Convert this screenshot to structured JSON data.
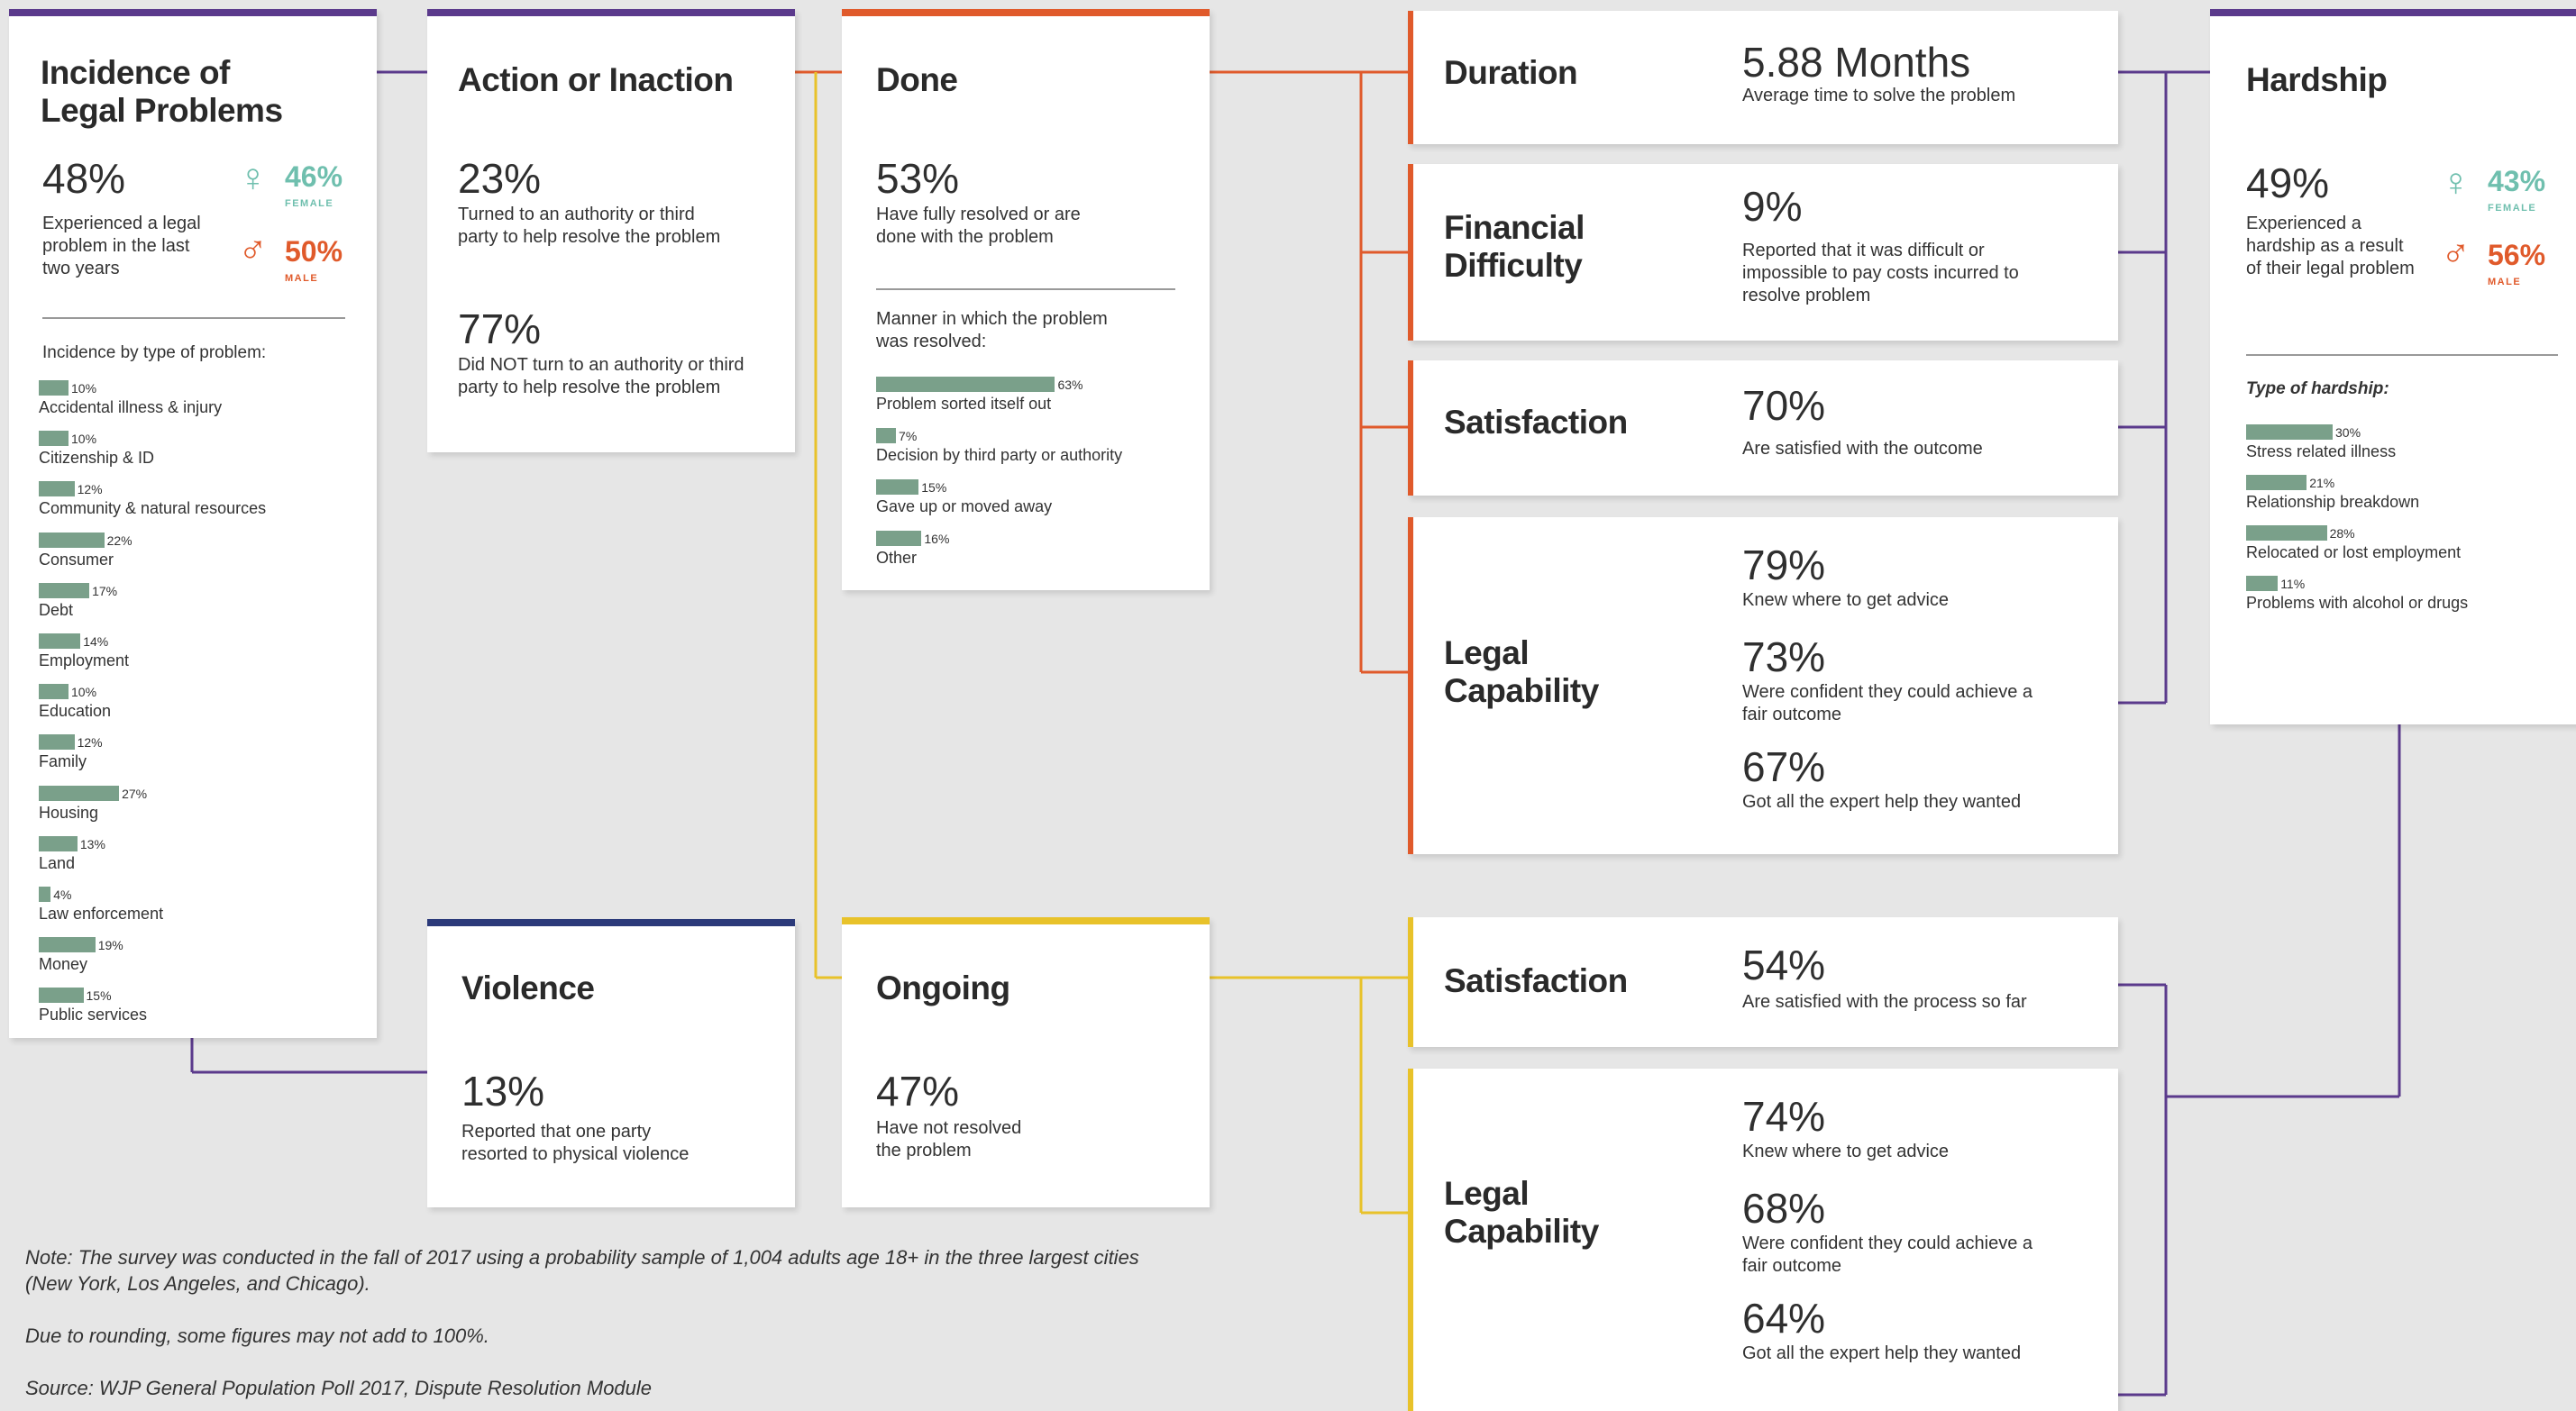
{
  "colors": {
    "purple": "#5b3a8c",
    "orange": "#e05a2b",
    "navy": "#2b3a7a",
    "yellow": "#e8c22a",
    "bar": "#7aa08a",
    "female": "#6fbfae"
  },
  "incidence": {
    "title_line1": "Incidence of",
    "title_line2": "Legal Problems",
    "pct": "48%",
    "desc_line1": "Experienced a legal",
    "desc_line2": "problem in the last",
    "desc_line3": "two years",
    "female_pct": "46%",
    "female_label": "FEMALE",
    "male_pct": "50%",
    "male_label": "MALE",
    "type_heading": "Incidence by type of problem:",
    "types": [
      {
        "label": "Accidental illness & injury",
        "value": 10,
        "pct": "10%"
      },
      {
        "label": "Citizenship & ID",
        "value": 10,
        "pct": "10%"
      },
      {
        "label": "Community & natural resources",
        "value": 12,
        "pct": "12%"
      },
      {
        "label": "Consumer",
        "value": 22,
        "pct": "22%"
      },
      {
        "label": "Debt",
        "value": 17,
        "pct": "17%"
      },
      {
        "label": "Employment",
        "value": 14,
        "pct": "14%"
      },
      {
        "label": "Education",
        "value": 10,
        "pct": "10%"
      },
      {
        "label": "Family",
        "value": 12,
        "pct": "12%"
      },
      {
        "label": "Housing",
        "value": 27,
        "pct": "27%"
      },
      {
        "label": "Land",
        "value": 13,
        "pct": "13%"
      },
      {
        "label": "Law enforcement",
        "value": 4,
        "pct": "4%"
      },
      {
        "label": "Money",
        "value": 19,
        "pct": "19%"
      },
      {
        "label": "Public services",
        "value": 15,
        "pct": "15%"
      }
    ]
  },
  "action": {
    "title": "Action or Inaction",
    "pct1": "23%",
    "desc1_line1": "Turned to an authority or third",
    "desc1_line2": "party to help resolve the problem",
    "pct2": "77%",
    "desc2_line1": "Did NOT turn to an authority or third",
    "desc2_line2": "party to help resolve the problem"
  },
  "done": {
    "title": "Done",
    "pct": "53%",
    "desc_line1": "Have fully resolved or are",
    "desc_line2": "done with the problem",
    "manner_line1": "Manner in which the problem",
    "manner_line2": "was resolved:",
    "manners": [
      {
        "label": "Problem sorted itself out",
        "value": 63,
        "pct": "63%"
      },
      {
        "label": "Decision by third party or authority",
        "value": 7,
        "pct": "7%"
      },
      {
        "label": "Gave up or moved away",
        "value": 15,
        "pct": "15%"
      },
      {
        "label": "Other",
        "value": 16,
        "pct": "16%"
      }
    ]
  },
  "duration": {
    "title": "Duration",
    "value": "5.88 Months",
    "desc": "Average time to solve the problem"
  },
  "financial": {
    "title_line1": "Financial",
    "title_line2": "Difficulty",
    "pct": "9%",
    "desc_line1": "Reported that it was difficult or",
    "desc_line2": "impossible to pay costs incurred to",
    "desc_line3": "resolve problem"
  },
  "satisfaction_done": {
    "title": "Satisfaction",
    "pct": "70%",
    "desc": "Are satisfied with the outcome"
  },
  "legal_done": {
    "title_line1": "Legal",
    "title_line2": "Capability",
    "items": [
      {
        "pct": "79%",
        "line1": "Knew where to get advice",
        "line2": ""
      },
      {
        "pct": "73%",
        "line1": "Were confident they could achieve a",
        "line2": "fair outcome"
      },
      {
        "pct": "67%",
        "line1": "Got all the expert help they wanted",
        "line2": ""
      }
    ]
  },
  "hardship": {
    "title": "Hardship",
    "pct": "49%",
    "desc_line1": "Experienced a",
    "desc_line2": "hardship as a result",
    "desc_line3": "of their legal problem",
    "female_pct": "43%",
    "female_label": "FEMALE",
    "male_pct": "56%",
    "male_label": "MALE",
    "type_heading": "Type of hardship:",
    "types": [
      {
        "label": "Stress related illness",
        "value": 30,
        "pct": "30%"
      },
      {
        "label": "Relationship breakdown",
        "value": 21,
        "pct": "21%"
      },
      {
        "label": "Relocated or lost employment",
        "value": 28,
        "pct": "28%"
      },
      {
        "label": "Problems with alcohol or drugs",
        "value": 11,
        "pct": "11%"
      }
    ]
  },
  "violence": {
    "title": "Violence",
    "pct": "13%",
    "desc_line1": "Reported that one party",
    "desc_line2": "resorted to physical violence"
  },
  "ongoing": {
    "title": "Ongoing",
    "pct": "47%",
    "desc_line1": "Have not resolved",
    "desc_line2": "the problem"
  },
  "satisfaction_ongoing": {
    "title": "Satisfaction",
    "pct": "54%",
    "desc": "Are satisfied with the process so far"
  },
  "legal_ongoing": {
    "title_line1": "Legal",
    "title_line2": "Capability",
    "items": [
      {
        "pct": "74%",
        "line1": "Knew where to get advice",
        "line2": ""
      },
      {
        "pct": "68%",
        "line1": "Were confident they could achieve a",
        "line2": "fair outcome"
      },
      {
        "pct": "64%",
        "line1": "Got all the expert help they wanted",
        "line2": ""
      }
    ]
  },
  "notes": {
    "note_line1": "Note: The survey was conducted in the fall of 2017 using a probability sample of 1,004 adults age 18+ in the three largest cities",
    "note_line2": "(New York, Los Angeles, and Chicago).",
    "rounding": "Due to rounding, some figures may not add to 100%.",
    "source": "Source: WJP General Population Poll 2017, Dispute Resolution Module"
  }
}
